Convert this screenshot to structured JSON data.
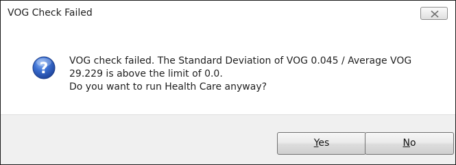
{
  "window": {
    "title": "VOG Check Failed"
  },
  "message": {
    "line1": "VOG check failed. The Standard Deviation of VOG 0.045 / Average VOG",
    "line2": "29.229 is above the limit of 0.0.",
    "line3": "Do you want to run Health Care anyway?"
  },
  "buttons": {
    "yes": {
      "mnemonic": "Y",
      "rest": "es"
    },
    "no": {
      "mnemonic": "N",
      "rest": "o"
    }
  },
  "icons": {
    "message_icon": "question-icon",
    "close": "close-icon"
  },
  "colors": {
    "icon_blue": "#2f63c8",
    "footer_bg": "#f0f0f0"
  }
}
